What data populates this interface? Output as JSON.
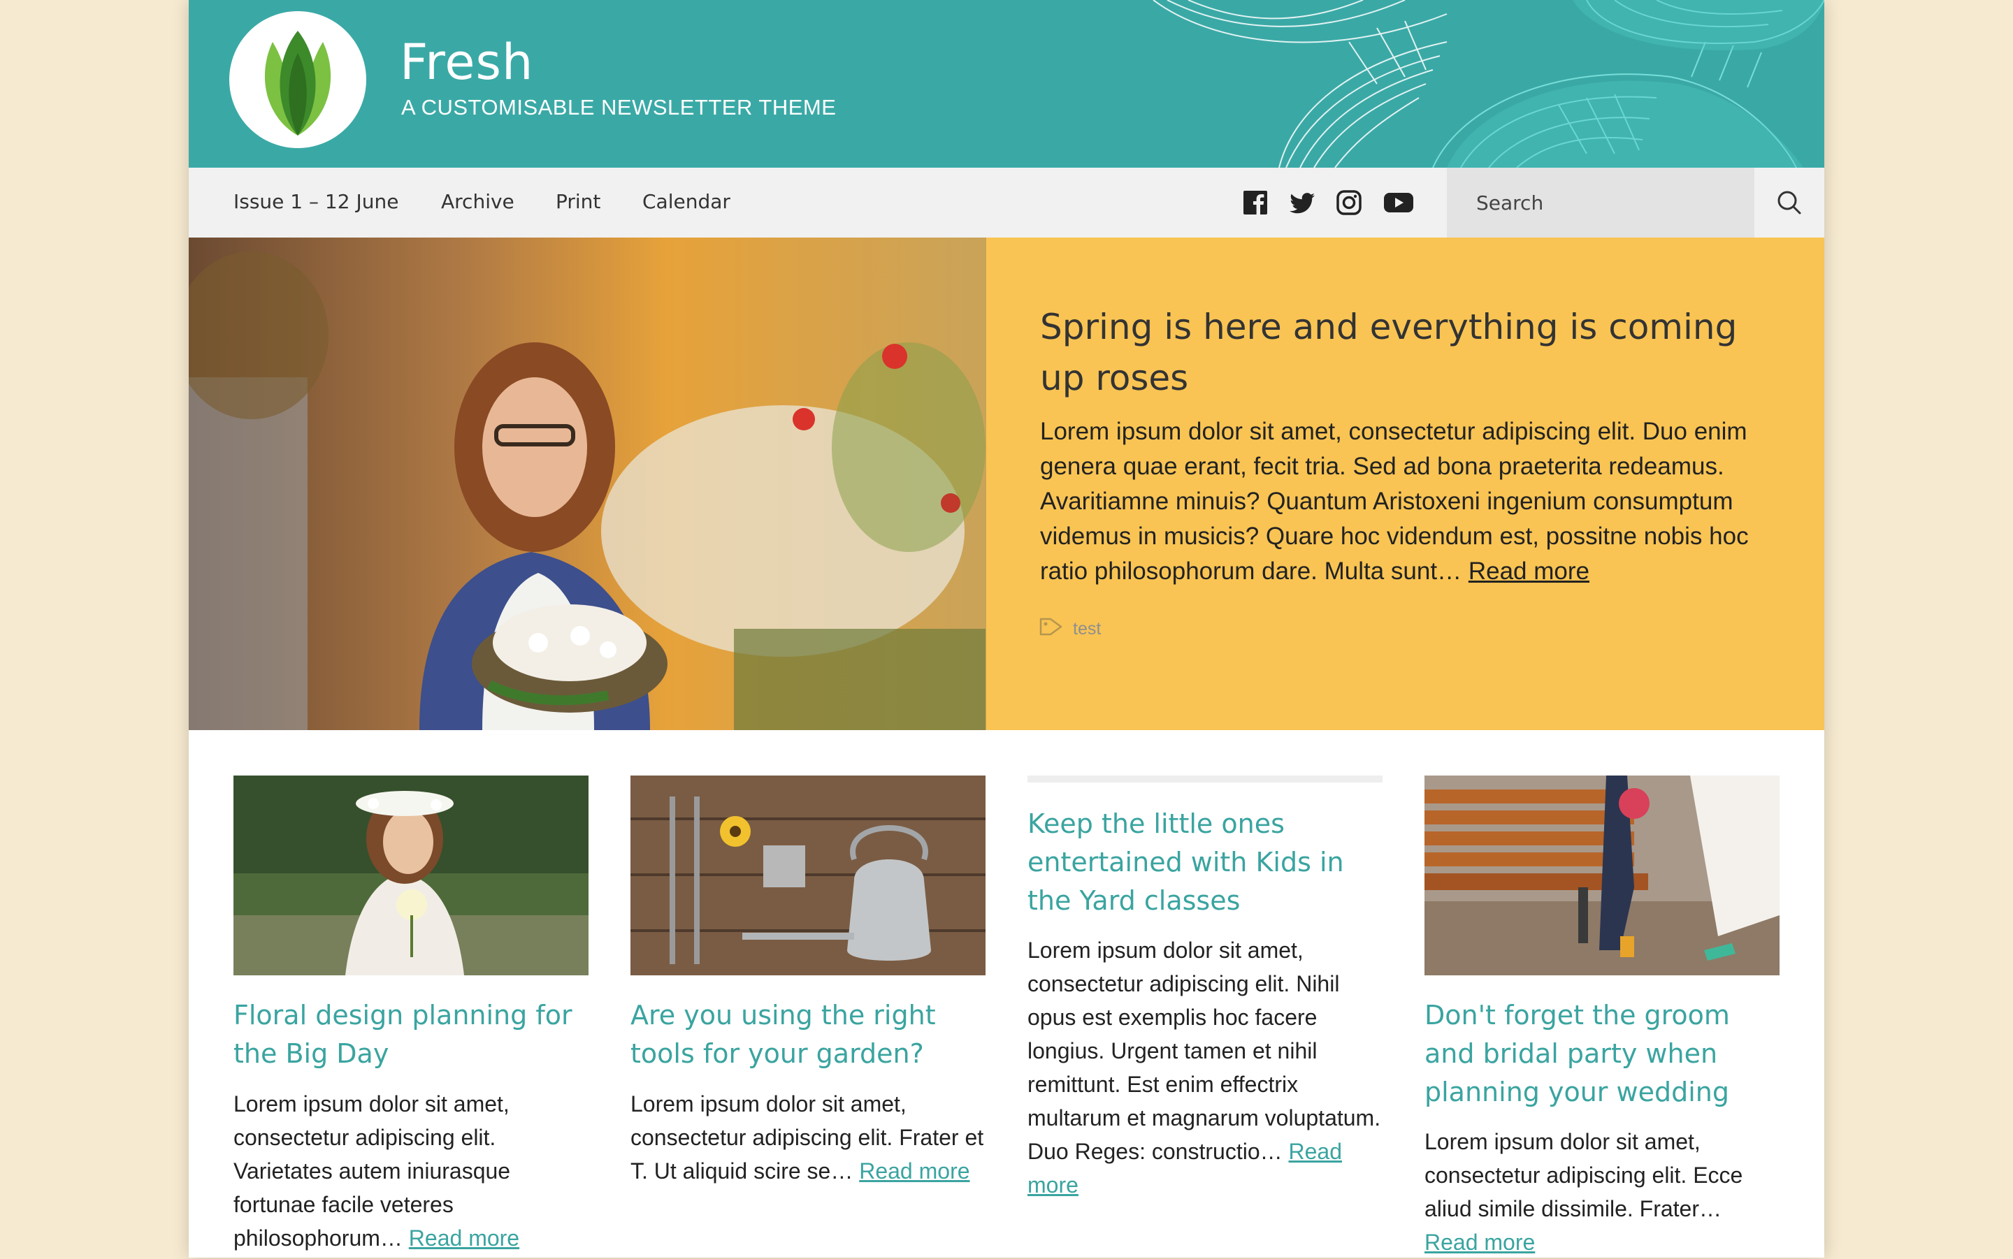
{
  "site": {
    "title": "Fresh",
    "tagline": "A CUSTOMISABLE NEWSLETTER THEME",
    "brand_color": "#3aa9a6"
  },
  "nav": {
    "items": [
      {
        "label": "Issue 1  –  12 June"
      },
      {
        "label": "Archive"
      },
      {
        "label": "Print"
      },
      {
        "label": "Calendar"
      }
    ],
    "social_icons": [
      "facebook-icon",
      "twitter-icon",
      "instagram-icon",
      "youtube-icon"
    ],
    "search_placeholder": "Search"
  },
  "featured": {
    "title": "Spring is here and everything is coming up roses",
    "excerpt": "Lorem ipsum dolor sit amet, consectetur adipiscing elit. Duo enim genera quae erant, fecit tria. Sed ad bona praeterita redeamus. Avaritiamne minuis? Quantum Aristoxeni ingenium consumptum videmus in musicis? Quare hoc videndum est, possitne nobis hoc ratio philosophorum dare. Multa sunt…",
    "read_more": "Read more",
    "tag": "test",
    "panel_color": "#f9c453"
  },
  "posts": [
    {
      "title": "Floral design planning for the Big Day",
      "excerpt": "Lorem ipsum dolor sit amet, consectetur adipiscing elit. Varietates autem iniurasque fortunae facile veteres philosophorum…",
      "read_more": "Read more"
    },
    {
      "title": "Are you using the right tools for your garden?",
      "excerpt": "Lorem ipsum dolor sit amet, consectetur adipiscing elit. Frater et T. Ut aliquid scire se…",
      "read_more": "Read more"
    },
    {
      "title": "Keep the little ones entertained with Kids in the Yard classes",
      "excerpt": "Lorem ipsum dolor sit amet, consectetur adipiscing elit. Nihil opus est exemplis hoc facere longius. Urgent tamen et nihil remittunt. Est enim effectrix multarum et magnarum voluptatum. Duo Reges: constructio…",
      "read_more": "Read more"
    },
    {
      "title": "Don't forget the groom and bridal party when planning your wedding",
      "excerpt": "Lorem ipsum dolor sit amet, consectetur adipiscing elit. Ecce aliud simile dissimile. Frater…",
      "read_more": "Read more"
    }
  ],
  "colors": {
    "link_teal": "#3aa4a0",
    "page_bg": "#f6ead0"
  }
}
